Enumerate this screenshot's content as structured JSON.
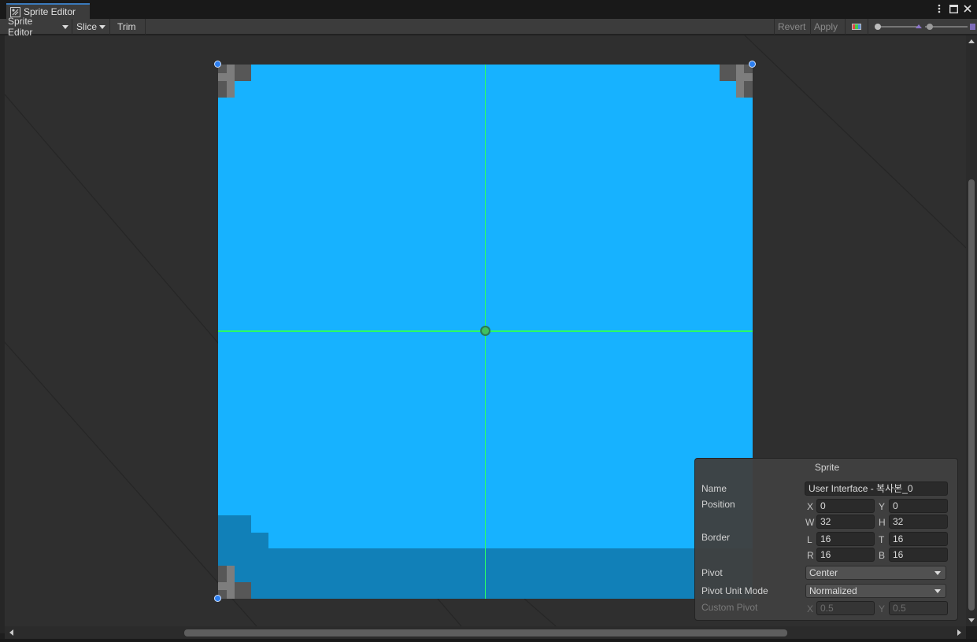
{
  "window": {
    "tab_title": "Sprite Editor",
    "tab_icon": "sprite-editor-icon",
    "controls": [
      "kebab-menu-icon",
      "maximize-icon",
      "close-icon"
    ]
  },
  "toolbar": {
    "sprite_editor_label": "Sprite Editor",
    "slice_label": "Slice",
    "trim_label": "Trim",
    "revert_label": "Revert",
    "apply_label": "Apply",
    "color_icon": "rgb-channel-icon",
    "zoom_slider_icon": "zoom-slider-icon",
    "mip_slider_icon": "mip-level-icon"
  },
  "colors": {
    "sprite": "#17b2ff",
    "sprite_shadow": "#1180b8",
    "guide": "#2bff64",
    "handle": "#2d7ff0"
  },
  "sprite_panel": {
    "title": "Sprite",
    "name_label": "Name",
    "name_value": "User Interface - 복사본_0",
    "position_label": "Position",
    "pos_x_label": "X",
    "pos_x": "0",
    "pos_y_label": "Y",
    "pos_y": "0",
    "pos_w_label": "W",
    "pos_w": "32",
    "pos_h_label": "H",
    "pos_h": "32",
    "border_label": "Border",
    "border_l_label": "L",
    "border_l": "16",
    "border_t_label": "T",
    "border_t": "16",
    "border_r_label": "R",
    "border_r": "16",
    "border_b_label": "B",
    "border_b": "16",
    "pivot_label": "Pivot",
    "pivot_value": "Center",
    "pivot_unit_label": "Pivot Unit Mode",
    "pivot_unit_value": "Normalized",
    "custom_pivot_label": "Custom Pivot",
    "custom_x_label": "X",
    "custom_x": "0.5",
    "custom_y_label": "Y",
    "custom_y": "0.5"
  }
}
